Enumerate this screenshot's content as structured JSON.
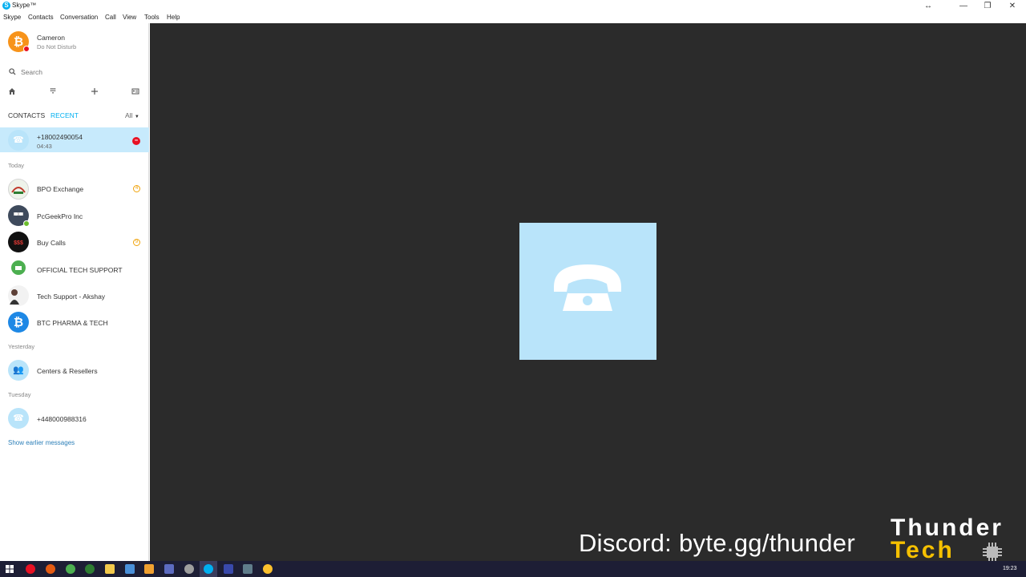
{
  "window": {
    "title": "Skype™",
    "logo": "S",
    "controls": [
      "↔",
      "—",
      "❐",
      "✕"
    ]
  },
  "menu": {
    "items": [
      {
        "label": "Skype"
      },
      {
        "label": "Contacts"
      },
      {
        "label": "Conversation"
      },
      {
        "label": "Call"
      },
      {
        "label": "View"
      },
      {
        "label": "Tools"
      },
      {
        "label": "Help"
      }
    ]
  },
  "profile": {
    "name": "Cameron",
    "status": "Do Not Disturb",
    "avatar_color": "#f7931a",
    "status_color": "#e81123"
  },
  "search": {
    "placeholder": "Search"
  },
  "toolbar": {
    "icons": [
      "home-icon",
      "dialpad-icon",
      "add-icon",
      "contacts-card-icon"
    ]
  },
  "tabs": {
    "contacts": "CONTACTS",
    "recent": "RECENT",
    "filter": "All"
  },
  "active_call": {
    "name": "+18002490054",
    "duration": "04:43"
  },
  "sections": {
    "today": "Today",
    "yesterday": "Yesterday",
    "tuesday": "Tuesday"
  },
  "recents": [
    {
      "name": "BPO Exchange",
      "badge": "4"
    },
    {
      "name": "PcGeekPro Inc"
    },
    {
      "name": "Buy Calls",
      "badge": "9"
    },
    {
      "name": "OFFICIAL TECH SUPPORT"
    },
    {
      "name": "Tech Support - Akshay"
    },
    {
      "name": "BTC PHARMA & TECH"
    },
    {
      "name": "Centers & Resellers"
    },
    {
      "name": "+448000988316"
    }
  ],
  "show_earlier": "Show earlier messages",
  "overlay": {
    "discord": "Discord: byte.gg/thunder",
    "brand_line1": "Thunder",
    "brand_line2": "Tech"
  },
  "taskbar": {
    "clock": "19:23"
  },
  "colors": {
    "skype_blue": "#00aff0",
    "active_row": "#c7eafc",
    "call_tile": "#b9e4fa",
    "main_bg": "#2b2b2b",
    "brand_yellow": "#f5c000"
  }
}
